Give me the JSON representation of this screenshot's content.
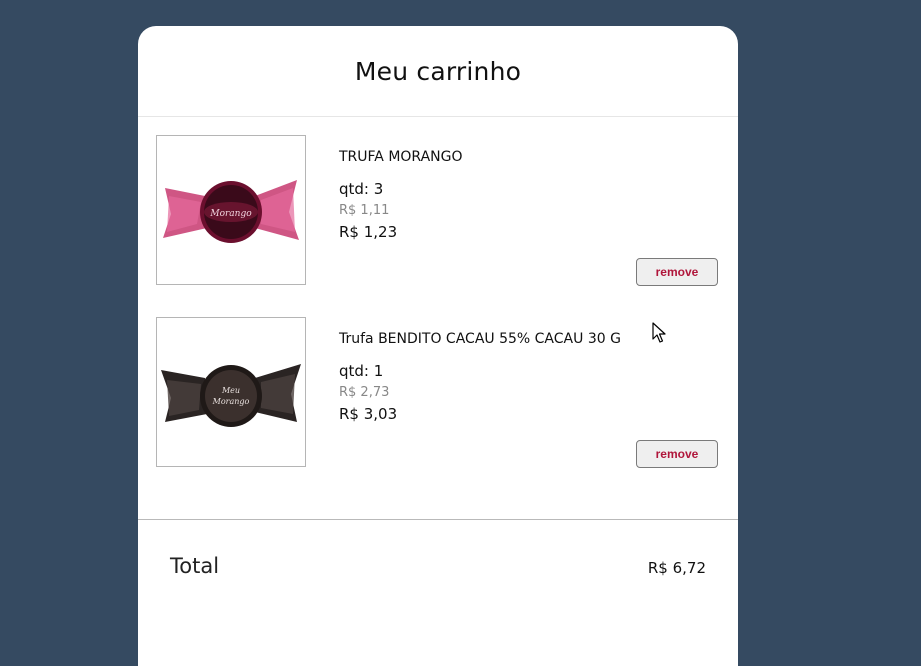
{
  "cart": {
    "title": "Meu carrinho",
    "items": [
      {
        "image": "truffle-morango-pink-wrapper",
        "name": "TRUFA MORANGO",
        "qty": "qtd: 3",
        "unit_price": "R$ 1,11",
        "subtotal": "R$ 1,23",
        "remove_label": "remove"
      },
      {
        "image": "truffle-chocolate-dark-wrapper",
        "name": "Trufa BENDITO CACAU 55% CACAU 30 G",
        "qty": "qtd: 1",
        "unit_price": "R$ 2,73",
        "subtotal": "R$ 3,03",
        "remove_label": "remove"
      }
    ],
    "total_label": "Total",
    "total_value": "R$ 6,72"
  },
  "colors": {
    "background": "#354a61",
    "card": "#ffffff",
    "remove_text": "#b0163b"
  }
}
